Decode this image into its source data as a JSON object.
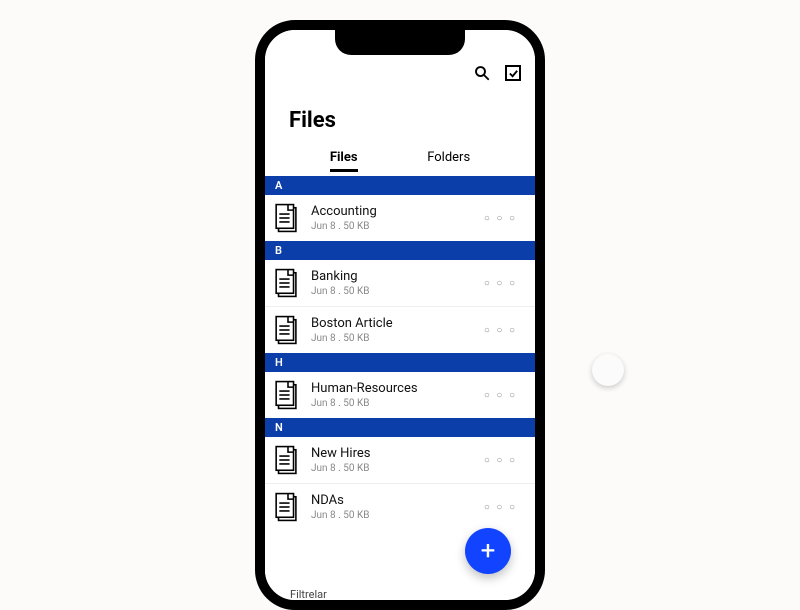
{
  "title": "Files",
  "tabs": [
    "Files",
    "Folders"
  ],
  "activeTab": 0,
  "colors": {
    "sectionHeader": "#0b3ea8",
    "fab": "#1244ff"
  },
  "sections": [
    {
      "letter": "A",
      "items": [
        {
          "name": "Accounting",
          "meta": "Jun 8 . 50 KB"
        }
      ]
    },
    {
      "letter": "B",
      "items": [
        {
          "name": "Banking",
          "meta": "Jun 8 . 50 KB"
        },
        {
          "name": "Boston Article",
          "meta": "Jun 8 . 50 KB"
        }
      ]
    },
    {
      "letter": "H",
      "items": [
        {
          "name": "Human-Resources",
          "meta": "Jun 8 . 50 KB"
        }
      ]
    },
    {
      "letter": "N",
      "items": [
        {
          "name": "New Hires",
          "meta": "Jun 8 . 50 KB"
        },
        {
          "name": "NDAs",
          "meta": "Jun 8 . 50 KB"
        }
      ]
    }
  ],
  "moreGlyph": "○ ○ ○",
  "fabGlyph": "+",
  "strayText": "Filtrelar"
}
